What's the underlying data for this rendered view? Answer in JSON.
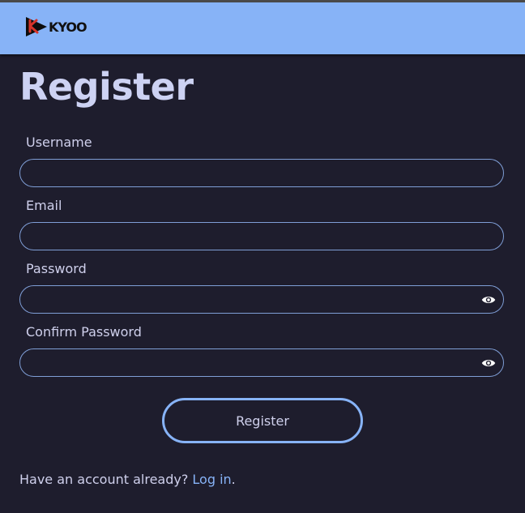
{
  "header": {
    "logo_text": "KYOO",
    "brand_color": "#87b3f7"
  },
  "page": {
    "title": "Register"
  },
  "form": {
    "username": {
      "label": "Username",
      "value": ""
    },
    "email": {
      "label": "Email",
      "value": ""
    },
    "password": {
      "label": "Password",
      "value": "",
      "icon": "eye-icon"
    },
    "confirm_password": {
      "label": "Confirm Password",
      "value": "",
      "icon": "eye-icon"
    },
    "submit_label": "Register"
  },
  "footer": {
    "prompt": "Have an account already? ",
    "login_link": "Log in",
    "suffix": "."
  },
  "colors": {
    "background": "#1e1d2d",
    "header": "#87b3f7",
    "accent": "#87b3f7",
    "text": "#cfd0ec"
  }
}
